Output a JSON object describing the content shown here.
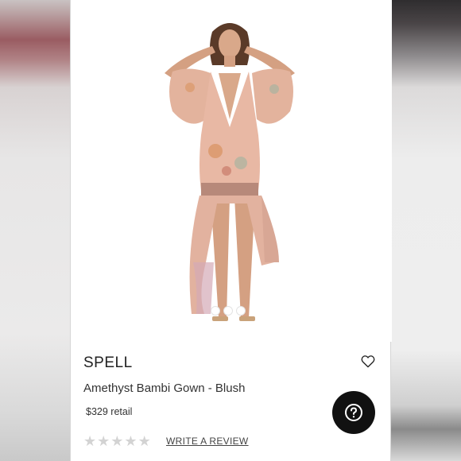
{
  "product": {
    "brand": "SPELL",
    "title": "Amethyst Bambi Gown - Blush",
    "price": "$329 retail",
    "rating": 0,
    "rating_max": 5,
    "write_review_label": "WRITE A REVIEW",
    "image_alt": "Model wearing blush floral gown"
  },
  "carousel": {
    "slide_count": 3,
    "active_index": 0
  },
  "icons": {
    "favorite": "heart-icon",
    "help": "question-icon",
    "star": "star-icon"
  },
  "colors": {
    "help_button": "#111111",
    "star_empty": "#d3d3d3",
    "dress": "#e8b8a4"
  }
}
